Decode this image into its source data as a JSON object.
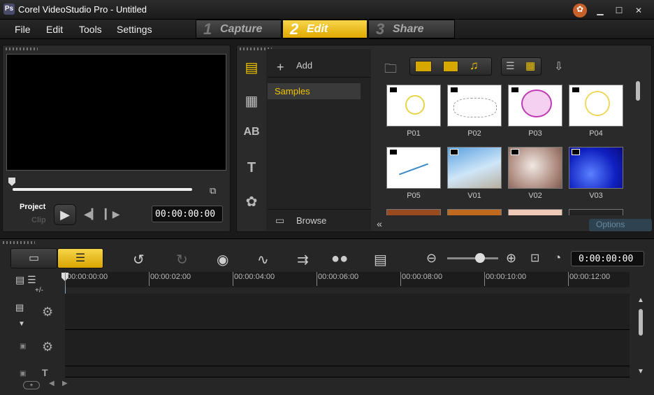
{
  "window": {
    "title": "Corel VideoStudio Pro - Untitled",
    "app_icon": "Ps"
  },
  "menu": {
    "items": [
      "File",
      "Edit",
      "Tools",
      "Settings"
    ]
  },
  "steps": [
    {
      "num": "1",
      "label": "Capture"
    },
    {
      "num": "2",
      "label": "Edit"
    },
    {
      "num": "3",
      "label": "Share"
    }
  ],
  "preview": {
    "mode_project": "Project",
    "mode_clip": "Clip",
    "timecode": "00:00:00:00"
  },
  "library": {
    "add_label": "Add",
    "folder": "Samples",
    "browse_label": "Browse",
    "options_label": "Options",
    "thumbs": [
      {
        "label": "P01"
      },
      {
        "label": "P02"
      },
      {
        "label": "P03"
      },
      {
        "label": "P04"
      },
      {
        "label": "P05"
      },
      {
        "label": "V01"
      },
      {
        "label": "V02"
      },
      {
        "label": "V03"
      }
    ]
  },
  "timeline": {
    "timecode": "0:00:00:00",
    "ruler": [
      "00:00:00:00",
      "00:00:02:00",
      "00:00:04:00",
      "00:00:06:00",
      "00:00:08:00",
      "00:00:10:00",
      "00:00:12:00"
    ],
    "track_controls": "+/-"
  },
  "colors": {
    "accent": "#f2c400",
    "text_yellow": "#f2c400"
  }
}
